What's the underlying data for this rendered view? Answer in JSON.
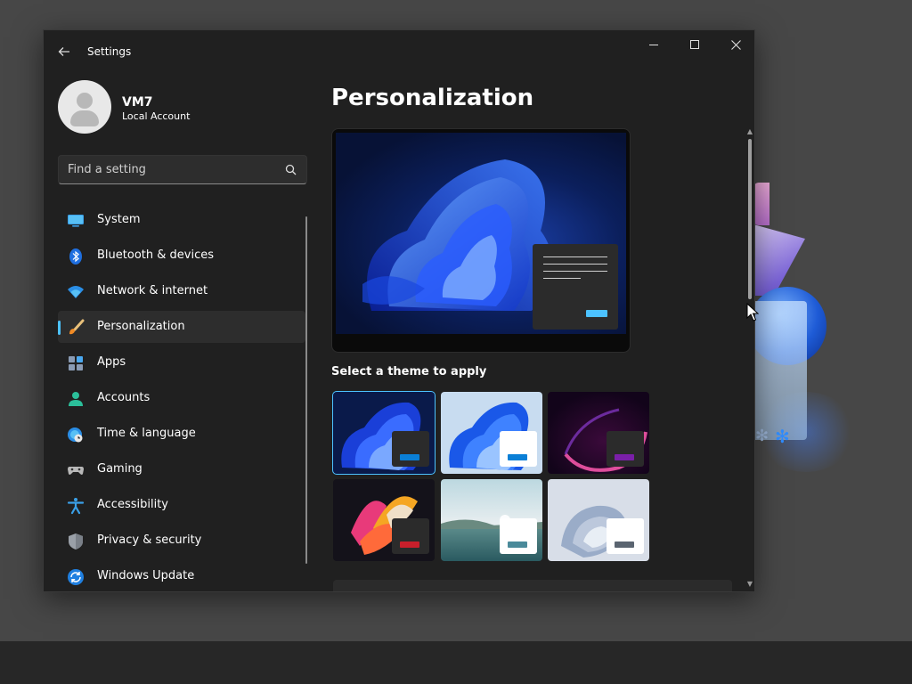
{
  "window": {
    "title": "Settings"
  },
  "user": {
    "name": "VM7",
    "account_type": "Local Account"
  },
  "search": {
    "placeholder": "Find a setting"
  },
  "nav": {
    "items": [
      {
        "label": "System",
        "icon": "monitor-icon",
        "selected": false
      },
      {
        "label": "Bluetooth & devices",
        "icon": "bluetooth-icon",
        "selected": false
      },
      {
        "label": "Network & internet",
        "icon": "wifi-icon",
        "selected": false
      },
      {
        "label": "Personalization",
        "icon": "paintbrush-icon",
        "selected": true
      },
      {
        "label": "Apps",
        "icon": "apps-icon",
        "selected": false
      },
      {
        "label": "Accounts",
        "icon": "person-icon",
        "selected": false
      },
      {
        "label": "Time & language",
        "icon": "globe-clock-icon",
        "selected": false
      },
      {
        "label": "Gaming",
        "icon": "gamepad-icon",
        "selected": false
      },
      {
        "label": "Accessibility",
        "icon": "accessibility-icon",
        "selected": false
      },
      {
        "label": "Privacy & security",
        "icon": "shield-icon",
        "selected": false
      },
      {
        "label": "Windows Update",
        "icon": "sync-icon",
        "selected": false
      }
    ]
  },
  "main": {
    "title": "Personalization",
    "themes_label": "Select a theme to apply",
    "themes": [
      {
        "name": "dark-bloom",
        "selected": true,
        "card": "#2b2b2b",
        "accent": "#0a7fd6"
      },
      {
        "name": "light-bloom",
        "selected": false,
        "card": "#ffffff",
        "accent": "#0a7fd6"
      },
      {
        "name": "glow",
        "selected": false,
        "card": "#2b2b2b",
        "accent": "#7a1fa8"
      },
      {
        "name": "captured-motion",
        "selected": false,
        "card": "#2b2b2b",
        "accent": "#c81f2b"
      },
      {
        "name": "sunrise",
        "selected": false,
        "card": "#ffffff",
        "accent": "#4a8a9a"
      },
      {
        "name": "flow",
        "selected": false,
        "card": "#ffffff",
        "accent": "#5a6470"
      }
    ]
  },
  "colors": {
    "accent": "#4cc2ff",
    "window_bg": "#202020",
    "nav_selected_bg": "#2d2d2d"
  }
}
